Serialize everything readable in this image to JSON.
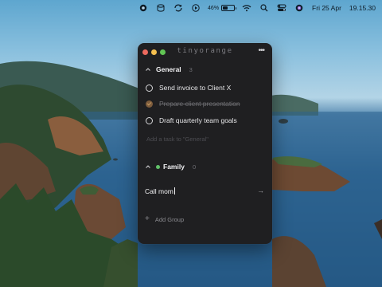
{
  "menubar": {
    "battery_percent": "46%",
    "date": "Fri 25 Apr",
    "time": "19.15.30"
  },
  "app": {
    "title": "tinyorange",
    "more_label": "•••"
  },
  "groups": [
    {
      "name": "General",
      "count": "3",
      "tasks": [
        {
          "text": "Send invoice to Client X",
          "completed": false
        },
        {
          "text": "Prepare client presentation",
          "completed": true
        },
        {
          "text": "Draft quarterly team goals",
          "completed": false
        }
      ],
      "add_task_placeholder": "Add a task to \"General\""
    },
    {
      "name": "Family",
      "count": "0",
      "input_value": "Call mom"
    }
  ],
  "add_group_label": "Add Group",
  "colors": {
    "window_bg": "#1f1f21",
    "family_dot": "#62c26a",
    "completed_check": "#7d5c3c"
  }
}
